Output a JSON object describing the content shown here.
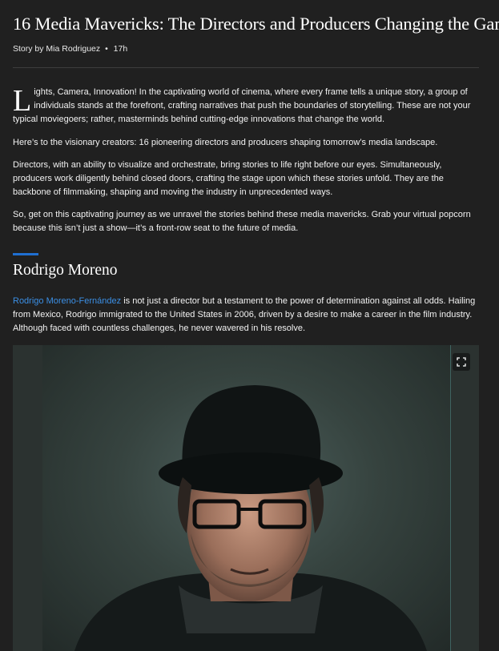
{
  "article": {
    "title": "16 Media Mavericks: The Directors and Producers Changing the Game",
    "byline": {
      "author": "Story by Mia Rodriguez",
      "separator": "•",
      "age": "17h"
    },
    "intro": {
      "dropcap": "L",
      "p1_rest": "ights, Camera, Innovation! In the captivating world of cinema, where every frame tells a unique story, a group of individuals stands at the forefront, crafting narratives that push the boundaries of storytelling. These are not your typical moviegoers; rather, masterminds behind cutting-edge innovations that change the world.",
      "p2": "Here’s to the visionary creators: 16 pioneering directors and producers shaping tomorrow’s media landscape.",
      "p3": "Directors, with an ability to visualize and orchestrate, bring stories to life right before our eyes. Simultaneously, producers work diligently behind closed doors, crafting the stage upon which these stories unfold. They are the backbone of filmmaking, shaping and moving the industry in unprecedented ways.",
      "p4": "So, get on this captivating journey as we unravel the stories behind these media mavericks. Grab your virtual popcorn because this isn’t just a show—it’s a front-row seat to the future of media."
    },
    "section": {
      "heading": "Rodrigo Moreno",
      "link_text": "Rodrigo Moreno-Fernández",
      "p_rest": " is not just a director but a testament to the power of determination against all odds. Hailing from Mexico, Rodrigo immigrated to the United States in 2006, driven by a desire to make a career in the film industry. Although faced with countless challenges, he never wavered in his resolve."
    }
  },
  "icons": {
    "expand": "expand-icon"
  },
  "colors": {
    "background": "#202020",
    "accent": "#1f6fd1",
    "link": "#3b8fe5"
  }
}
